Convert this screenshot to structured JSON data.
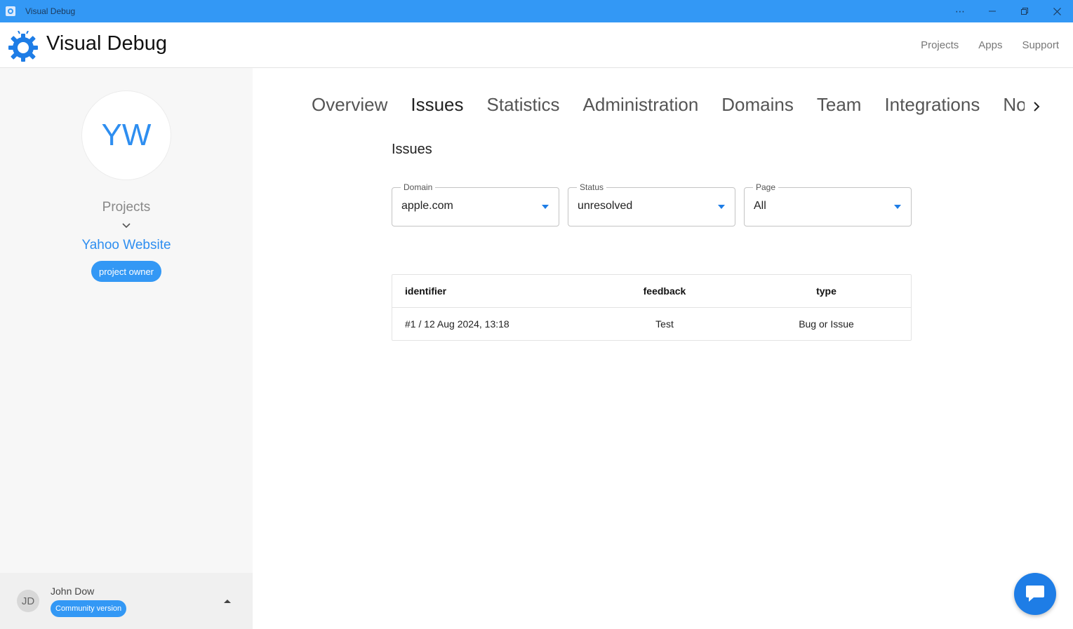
{
  "window": {
    "title": "Visual Debug",
    "controls": {
      "more": "⋯",
      "minimize": "—",
      "restore": "❐",
      "close": "✕"
    }
  },
  "header": {
    "brand": "Visual Debug",
    "nav": [
      "Projects",
      "Apps",
      "Support"
    ]
  },
  "sidebar": {
    "avatar_initials": "YW",
    "projects_label": "Projects",
    "project_name": "Yahoo Website",
    "role_badge": "project owner",
    "user": {
      "initials": "JD",
      "name": "John Dow",
      "version_badge": "Community version"
    }
  },
  "tabs": [
    "Overview",
    "Issues",
    "Statistics",
    "Administration",
    "Domains",
    "Team",
    "Integrations",
    "Notifications"
  ],
  "active_tab": "Issues",
  "main": {
    "title": "Issues",
    "filters": {
      "domain": {
        "label": "Domain",
        "value": "apple.com"
      },
      "status": {
        "label": "Status",
        "value": "unresolved"
      },
      "page": {
        "label": "Page",
        "value": "All"
      }
    },
    "table": {
      "columns": [
        "identifier",
        "feedback",
        "type"
      ],
      "rows": [
        [
          "#1 / 12 Aug 2024, 13:18",
          "Test",
          "Bug or Issue"
        ]
      ]
    }
  },
  "icons": {
    "logo": "gear-bug-icon",
    "chat": "chat-bubble-icon",
    "next": "chevron-right-icon"
  },
  "colors": {
    "accent": "#3398f5",
    "link": "#2e8ef0",
    "fab": "#1e7de6"
  }
}
